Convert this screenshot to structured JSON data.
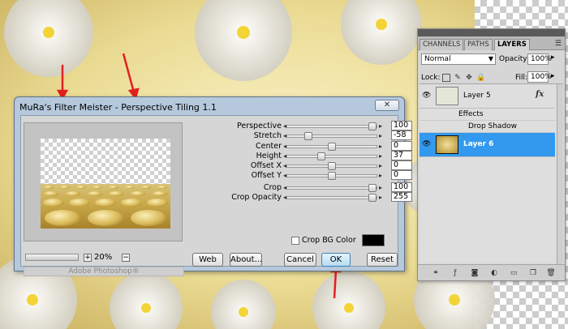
{
  "colors": {
    "dialog_frame": "#b5c8dc",
    "dialog_body": "#d6d6d6",
    "selected_layer": "#3399ee",
    "annotation_arrow": "#e32020",
    "crop_bg_color": "#000000"
  },
  "dialog": {
    "title": "MuRa's Filter Meister - Perspective Tiling 1.1",
    "close_icon": "close-icon",
    "zoom": {
      "minus": "−",
      "plus": "+",
      "value": "20%"
    },
    "brand": "Adobe Photoshop®",
    "params": [
      {
        "label": "Perspective",
        "value": "100",
        "level": 1.0
      },
      {
        "label": "Stretch",
        "value": "-58",
        "level": 0.21
      },
      {
        "label": "Center",
        "value": "0",
        "level": 0.5
      },
      {
        "label": "Height",
        "value": "37",
        "level": 0.37
      },
      {
        "label": "Offset X",
        "value": "0",
        "level": 0.5
      },
      {
        "label": "Offset Y",
        "value": "0",
        "level": 0.5
      },
      {
        "label": "Crop",
        "value": "100",
        "level": 1.0
      },
      {
        "label": "Crop Opacity",
        "value": "255",
        "level": 1.0
      }
    ],
    "crop_bg_label": "Crop BG Color",
    "buttons": {
      "web": "Web",
      "about": "About...",
      "cancel": "Cancel",
      "ok": "OK",
      "reset": "Reset"
    }
  },
  "layers_panel": {
    "tabs": [
      "CHANNELS",
      "PATHS",
      "LAYERS"
    ],
    "menu_icon": "panel-menu-icon",
    "blend_mode": "Normal",
    "opacity_label": "Opacity:",
    "opacity_value": "100%",
    "lock_label": "Lock:",
    "fill_label": "Fill:",
    "fill_value": "100%",
    "layers": [
      {
        "name": "Layer 5",
        "fx": "fx",
        "effects_label": "Effects",
        "effect": "Drop Shadow"
      },
      {
        "name": "Layer 6"
      }
    ]
  }
}
